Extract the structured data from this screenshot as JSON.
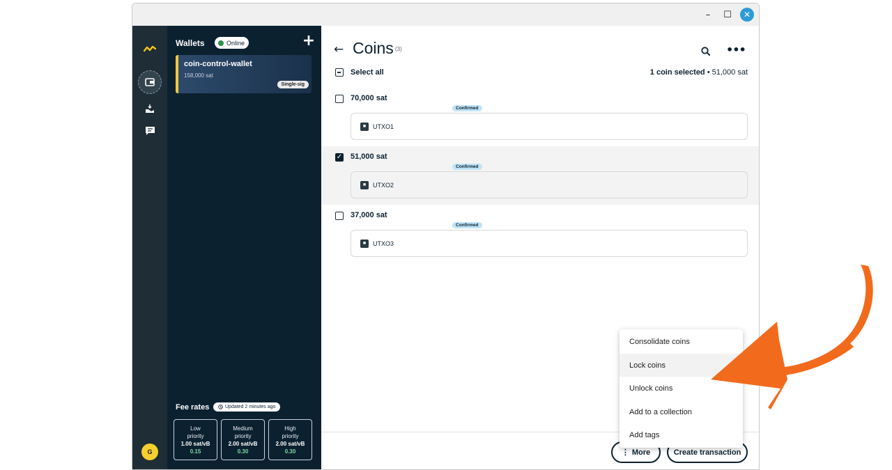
{
  "window": {
    "minimize_glyph": "–",
    "maximize_glyph": "☐",
    "close_glyph": "✕",
    "accent": "#2e9bd7"
  },
  "rail": {
    "logo_icon": "sparrow-logo-icon",
    "items": [
      {
        "icon": "wallet-icon",
        "active": true
      },
      {
        "icon": "send-receive-icon",
        "active": false
      },
      {
        "icon": "chat-icon",
        "active": false
      }
    ],
    "avatar_initial": "G"
  },
  "sidebar": {
    "wallets_title": "Wallets",
    "status_badge": "Online",
    "add_glyph": "+",
    "wallet": {
      "name": "coin-control-wallet",
      "balance": "158,000 sat",
      "type": "Single-sig"
    },
    "fee_rates": {
      "title": "Fee rates",
      "updated": "Updated 2 minutes ago",
      "boxes": [
        {
          "line1": "Low",
          "line2": "priority",
          "rate": "1.00 sat/vB",
          "fiat": "0.15"
        },
        {
          "line1": "Medium",
          "line2": "priority",
          "rate": "2.00 sat/vB",
          "fiat": "0.30"
        },
        {
          "line1": "High",
          "line2": "priority",
          "rate": "2.00 sat/vB",
          "fiat": "0.30"
        }
      ]
    }
  },
  "main": {
    "back_glyph": "←",
    "title": "Coins",
    "count": "(3)",
    "more_glyph": "•••",
    "select_all": "Select all",
    "selection_bold": "1 coin selected",
    "selection_rest": " • 51,000 sat",
    "coins": [
      {
        "amount": "70,000 sat",
        "status": "Confirmed",
        "label": "UTXO1",
        "selected": false
      },
      {
        "amount": "51,000 sat",
        "status": "Confirmed",
        "label": "UTXO2",
        "selected": true
      },
      {
        "amount": "37,000 sat",
        "status": "Confirmed",
        "label": "UTXO3",
        "selected": false
      }
    ],
    "more_button": "More",
    "more_button_glyph": "⋮",
    "create_transaction": "Create transaction"
  },
  "dropdown": {
    "items": [
      "Consolidate coins",
      "Lock coins",
      "Unlock coins",
      "Add to a collection",
      "Add tags"
    ],
    "highlighted": "Lock coins"
  },
  "annotation": {
    "color": "#f26b1d"
  }
}
